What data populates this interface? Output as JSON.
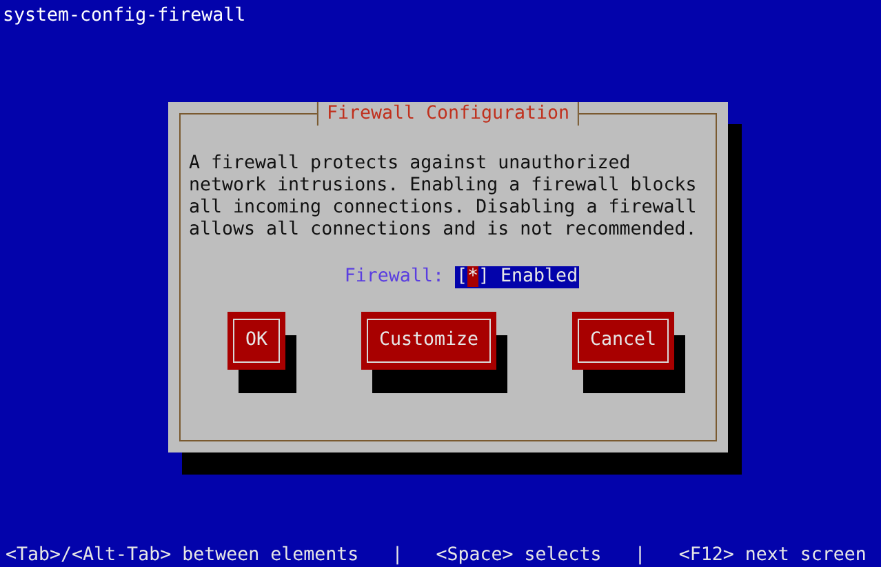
{
  "window": {
    "title": "system-config-firewall"
  },
  "dialog": {
    "title": "Firewall Configuration",
    "message": "A firewall protects against unauthorized network intrusions. Enabling a firewall blocks all incoming connections. Disabling a firewall allows all connections and is not recommended.",
    "firewall": {
      "label": "Firewall:",
      "checked": true,
      "box_open": "[",
      "mark": "*",
      "box_close": "]",
      "focused": true,
      "option": "Enabled"
    },
    "buttons": [
      "OK",
      "Customize",
      "Cancel"
    ]
  },
  "status_bar": [
    "<Tab>/<Alt-Tab> between elements",
    "|",
    "<Space> selects",
    "|",
    "<F12> next screen"
  ]
}
